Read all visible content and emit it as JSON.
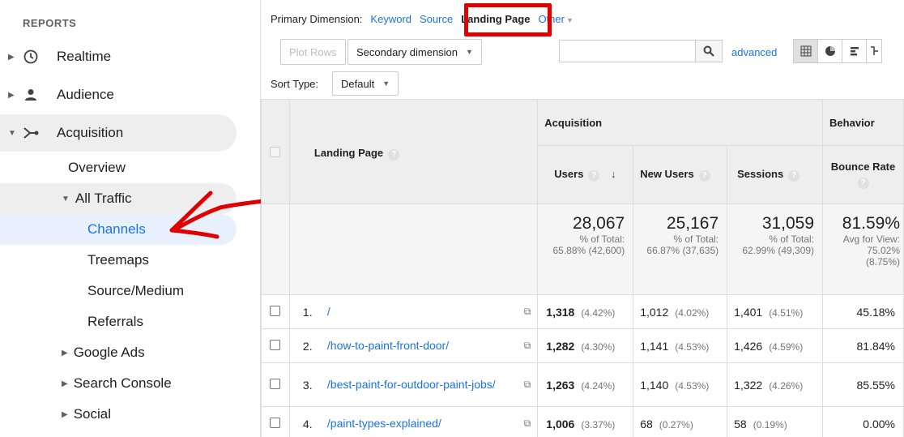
{
  "sidebar": {
    "header": "REPORTS",
    "items": [
      {
        "label": "Realtime"
      },
      {
        "label": "Audience"
      },
      {
        "label": "Acquisition"
      }
    ],
    "acquisition_sub": [
      {
        "label": "Overview"
      },
      {
        "label": "All Traffic"
      },
      {
        "label": "Channels"
      },
      {
        "label": "Treemaps"
      },
      {
        "label": "Source/Medium"
      },
      {
        "label": "Referrals"
      },
      {
        "label": "Google Ads"
      },
      {
        "label": "Search Console"
      },
      {
        "label": "Social"
      }
    ]
  },
  "toolbar": {
    "primary_dimension_label": "Primary Dimension:",
    "dims": [
      "Keyword",
      "Source",
      "Landing Page",
      "Other"
    ],
    "plot_rows": "Plot Rows",
    "secondary_dimension": "Secondary dimension",
    "advanced": "advanced",
    "sort_type_label": "Sort Type:",
    "sort_type_value": "Default",
    "search_value": ""
  },
  "table": {
    "col_landing_page": "Landing Page",
    "group_acquisition": "Acquisition",
    "group_behavior": "Behavior",
    "col_users": "Users",
    "col_new_users": "New Users",
    "col_sessions": "Sessions",
    "col_bounce_rate": "Bounce Rate",
    "totals": {
      "users": "28,067",
      "users_pct": "% of Total:",
      "users_sub": "65.88% (42,600)",
      "new_users": "25,167",
      "new_users_pct": "% of Total:",
      "new_users_sub": "66.87% (37,635)",
      "sessions": "31,059",
      "sessions_pct": "% of Total:",
      "sessions_sub": "62.99% (49,309)",
      "bounce": "81.59%",
      "bounce_l1": "Avg for View:",
      "bounce_l2": "75.02%",
      "bounce_l3": "(8.75%)"
    },
    "rows": [
      {
        "num": "1.",
        "page": "/",
        "users": "1,318",
        "users_pct": "(4.42%)",
        "new_users": "1,012",
        "new_users_pct": "(4.02%)",
        "sessions": "1,401",
        "sessions_pct": "(4.51%)",
        "bounce": "45.18%"
      },
      {
        "num": "2.",
        "page": "/how-to-paint-front-door/",
        "users": "1,282",
        "users_pct": "(4.30%)",
        "new_users": "1,141",
        "new_users_pct": "(4.53%)",
        "sessions": "1,426",
        "sessions_pct": "(4.59%)",
        "bounce": "81.84%"
      },
      {
        "num": "3.",
        "page": "/best-paint-for-outdoor-paint-jobs/",
        "users": "1,263",
        "users_pct": "(4.24%)",
        "new_users": "1,140",
        "new_users_pct": "(4.53%)",
        "sessions": "1,322",
        "sessions_pct": "(4.26%)",
        "bounce": "85.55%"
      },
      {
        "num": "4.",
        "page": "/paint-types-explained/",
        "users": "1,006",
        "users_pct": "(3.37%)",
        "new_users": "68",
        "new_users_pct": "(0.27%)",
        "sessions": "58",
        "sessions_pct": "(0.19%)",
        "bounce": "0.00%"
      }
    ]
  },
  "colors": {
    "link": "#1a73e8",
    "highlight_red": "#e00000",
    "selected_bg": "#e8f0fe"
  }
}
